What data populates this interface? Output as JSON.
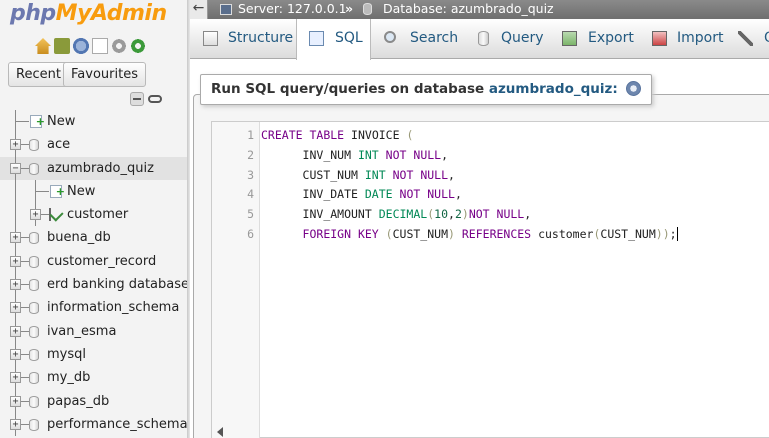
{
  "logo": {
    "php": "php",
    "myadmin": "MyAdmin"
  },
  "logo_icons": [
    "home-icon",
    "exit-icon",
    "help-icon",
    "docs-icon",
    "settings-icon",
    "reload-icon"
  ],
  "nav": {
    "recent_label": "Recent",
    "favourites_label": "Favourites",
    "tree": [
      {
        "label": "New",
        "kind": "new",
        "level": 0
      },
      {
        "label": "ace",
        "kind": "db",
        "level": 0
      },
      {
        "label": "azumbrado_quiz",
        "kind": "db",
        "level": 0,
        "expanded": true,
        "selected": true
      },
      {
        "label": "New",
        "kind": "new",
        "level": 1
      },
      {
        "label": "customer",
        "kind": "table",
        "level": 1
      },
      {
        "label": "buena_db",
        "kind": "db",
        "level": 0
      },
      {
        "label": "customer_record",
        "kind": "db",
        "level": 0
      },
      {
        "label": "erd banking database",
        "kind": "db",
        "level": 0
      },
      {
        "label": "information_schema",
        "kind": "db",
        "level": 0
      },
      {
        "label": "ivan_esma",
        "kind": "db",
        "level": 0
      },
      {
        "label": "mysql",
        "kind": "db",
        "level": 0
      },
      {
        "label": "my_db",
        "kind": "db",
        "level": 0
      },
      {
        "label": "papas_db",
        "kind": "db",
        "level": 0
      },
      {
        "label": "performance_schema",
        "kind": "db",
        "level": 0
      }
    ]
  },
  "breadcrumb": {
    "server": "Server: 127.0.0.1",
    "separator": "»",
    "database": "Database: azumbrado_quiz"
  },
  "tabs": [
    {
      "label": "Structure",
      "icon": "structure-icon",
      "active": false
    },
    {
      "label": "SQL",
      "icon": "sql-icon",
      "active": true
    },
    {
      "label": "Search",
      "icon": "search-icon",
      "active": false
    },
    {
      "label": "Query",
      "icon": "query-icon",
      "active": false
    },
    {
      "label": "Export",
      "icon": "export-icon",
      "active": false
    },
    {
      "label": "Import",
      "icon": "import-icon",
      "active": false
    },
    {
      "label": "O",
      "icon": "wrench-icon",
      "active": false
    }
  ],
  "sql_panel": {
    "legend_prefix": "Run SQL query/queries on database",
    "database": "azumbrado_quiz:",
    "help_icon": "help-icon"
  },
  "editor": {
    "lines": [
      {
        "num": "1",
        "text": "CREATE TABLE INVOICE ("
      },
      {
        "num": "2",
        "text": "      INV_NUM INT NOT NULL,"
      },
      {
        "num": "3",
        "text": "      CUST_NUM INT NOT NULL,"
      },
      {
        "num": "4",
        "text": "      INV_DATE DATE NOT NULL,"
      },
      {
        "num": "5",
        "text": "      INV_AMOUNT DECIMAL(10,2)NOT NULL,"
      },
      {
        "num": "6",
        "text": "      FOREIGN KEY (CUST_NUM) REFERENCES customer(CUST_NUM));"
      }
    ]
  },
  "colors": {
    "keyword": "#770088",
    "type": "#008855",
    "link": "#235a81",
    "logo_php": "#6c78af",
    "logo_admin": "#f89c0e"
  }
}
